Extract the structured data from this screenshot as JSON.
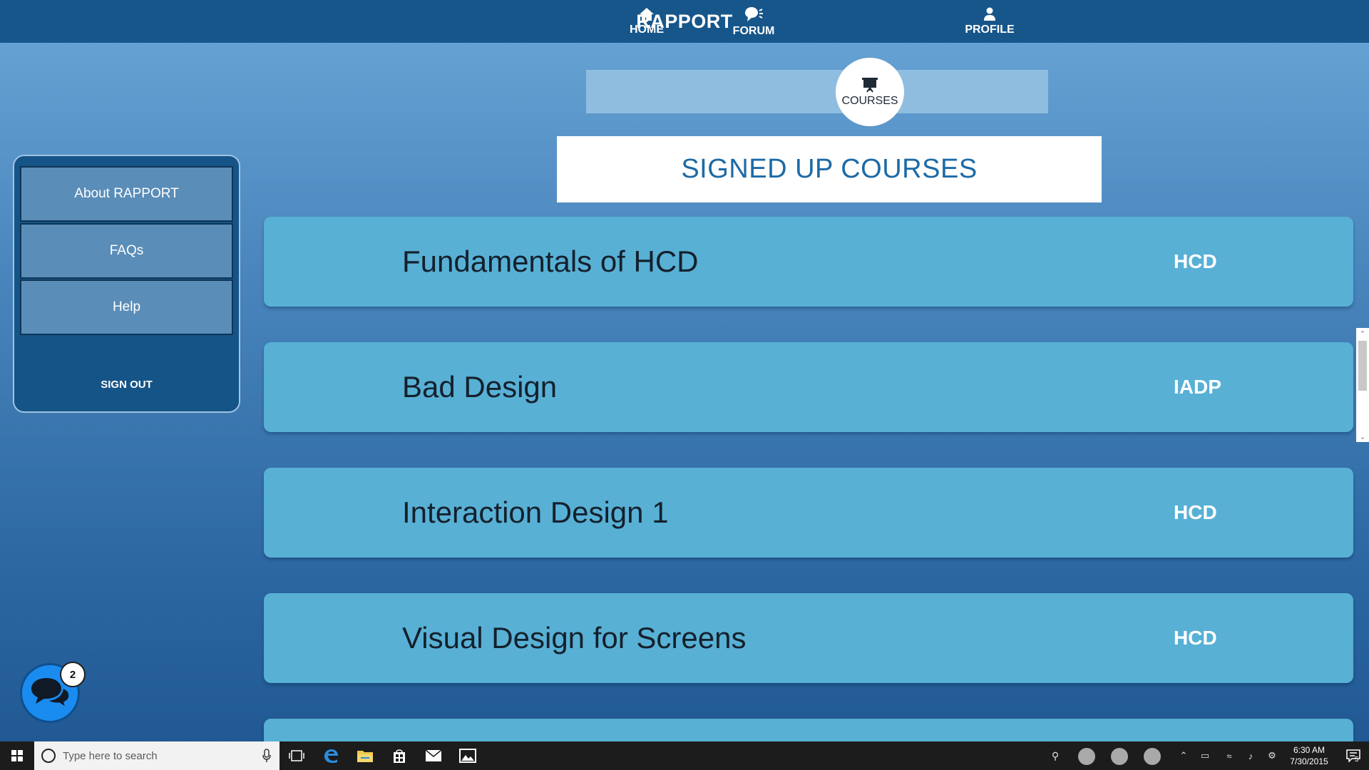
{
  "header": {
    "title": "RAPPORT"
  },
  "nav": {
    "items": [
      {
        "label": "HOME",
        "icon": "home-icon"
      },
      {
        "label": "FORUM",
        "icon": "forum-icon"
      },
      {
        "label": "COURSES",
        "icon": "courses-icon",
        "active": true
      },
      {
        "label": "PROFILE",
        "icon": "profile-icon"
      }
    ]
  },
  "main": {
    "title": "SIGNED UP COURSES",
    "courses": [
      {
        "name": "Fundamentals of HCD",
        "code": "HCD"
      },
      {
        "name": "Bad Design",
        "code": "IADP"
      },
      {
        "name": "Interaction Design 1",
        "code": "HCD"
      },
      {
        "name": "Visual Design for Screens",
        "code": "HCD"
      }
    ]
  },
  "sidebar": {
    "items": [
      {
        "label": "About RAPPORT"
      },
      {
        "label": "FAQs"
      },
      {
        "label": "Help"
      }
    ],
    "sign_out": "SIGN OUT"
  },
  "chat": {
    "badge_count": "2"
  },
  "taskbar": {
    "search_placeholder": "Type here to search",
    "time": "6:30 AM",
    "date": "7/30/2015",
    "notification_count": "5"
  },
  "colors": {
    "header_bg": "#17568a",
    "nav_bg": "#8fbde0",
    "card_bg": "#58b0d5",
    "title_text": "#1c6aa6",
    "sidebar_bg": "#155487",
    "chat_bg": "#1a8cf0"
  }
}
